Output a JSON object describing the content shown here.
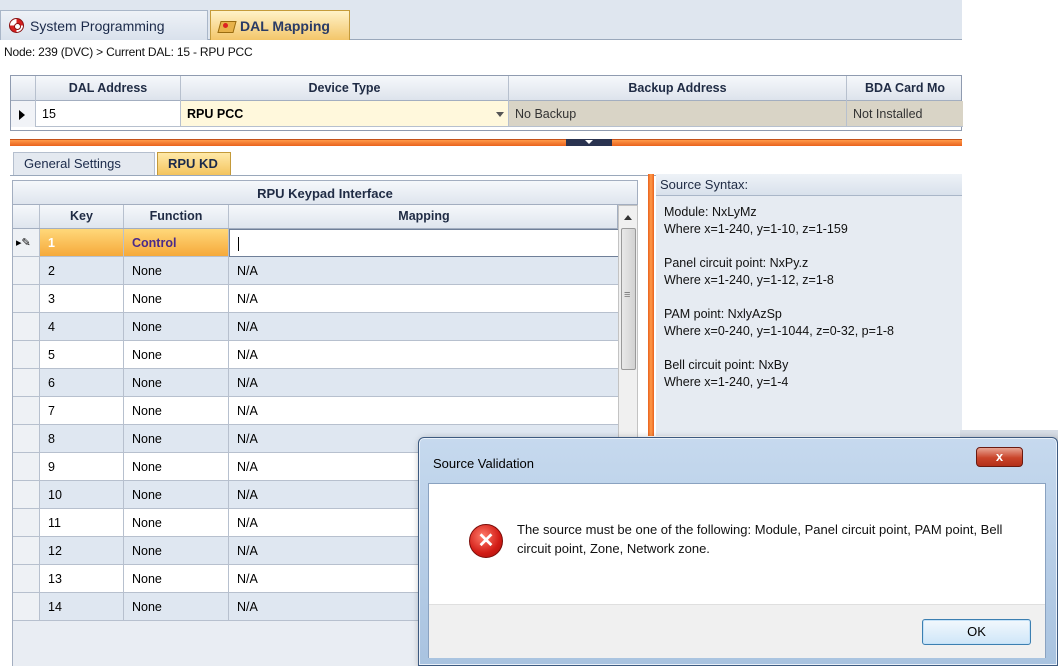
{
  "top_tabs": [
    {
      "label": "System Programming"
    },
    {
      "label": "DAL Mapping"
    }
  ],
  "breadcrumb": "Node: 239 (DVC) > Current DAL: 15 - RPU PCC",
  "dal_grid": {
    "headers": {
      "dal_address": "DAL Address",
      "device_type": "Device Type",
      "backup_address": "Backup Address",
      "bda_card": "BDA Card Mo"
    },
    "row": {
      "dal_address": "15",
      "device_type": "RPU PCC",
      "backup_address": "No Backup",
      "bda_card": "Not Installed"
    }
  },
  "sub_tabs": [
    {
      "label": "General Settings"
    },
    {
      "label": "RPU KD"
    }
  ],
  "keypad": {
    "title": "RPU Keypad Interface",
    "headers": {
      "key": "Key",
      "function": "Function",
      "mapping": "Mapping"
    },
    "rows": [
      {
        "key": "1",
        "function": "Control",
        "mapping": ""
      },
      {
        "key": "2",
        "function": "None",
        "mapping": "N/A"
      },
      {
        "key": "3",
        "function": "None",
        "mapping": "N/A"
      },
      {
        "key": "4",
        "function": "None",
        "mapping": "N/A"
      },
      {
        "key": "5",
        "function": "None",
        "mapping": "N/A"
      },
      {
        "key": "6",
        "function": "None",
        "mapping": "N/A"
      },
      {
        "key": "7",
        "function": "None",
        "mapping": "N/A"
      },
      {
        "key": "8",
        "function": "None",
        "mapping": "N/A"
      },
      {
        "key": "9",
        "function": "None",
        "mapping": "N/A"
      },
      {
        "key": "10",
        "function": "None",
        "mapping": "N/A"
      },
      {
        "key": "11",
        "function": "None",
        "mapping": "N/A"
      },
      {
        "key": "12",
        "function": "None",
        "mapping": "N/A"
      },
      {
        "key": "13",
        "function": "None",
        "mapping": "N/A"
      },
      {
        "key": "14",
        "function": "None",
        "mapping": "N/A"
      }
    ]
  },
  "source_syntax": {
    "title": "Source Syntax:",
    "blocks": [
      {
        "name": "Module: NxLyMz",
        "range": "Where x=1-240, y=1-10, z=1-159"
      },
      {
        "name": "Panel circuit point: NxPy.z",
        "range": "Where x=1-240, y=1-12, z=1-8"
      },
      {
        "name": "PAM point: NxlyAzSp",
        "range": "Where x=0-240, y=1-1044, z=0-32, p=1-8"
      },
      {
        "name": "Bell circuit point: NxBy",
        "range": "Where x=1-240, y=1-4"
      }
    ]
  },
  "dialog": {
    "title": "Source Validation",
    "message": "The source must be one of the following: Module, Panel circuit point, PAM point, Bell circuit point, Zone, Network zone.",
    "close_label": "x",
    "ok_label": "OK"
  },
  "icons": {
    "system_programming": "lifebuoy-icon",
    "dal_mapping": "map-icon",
    "error": "error-icon"
  },
  "colors": {
    "accent_orange": "#e9621c",
    "active_tab": "#f3c66a",
    "error_red": "#d21c16"
  }
}
